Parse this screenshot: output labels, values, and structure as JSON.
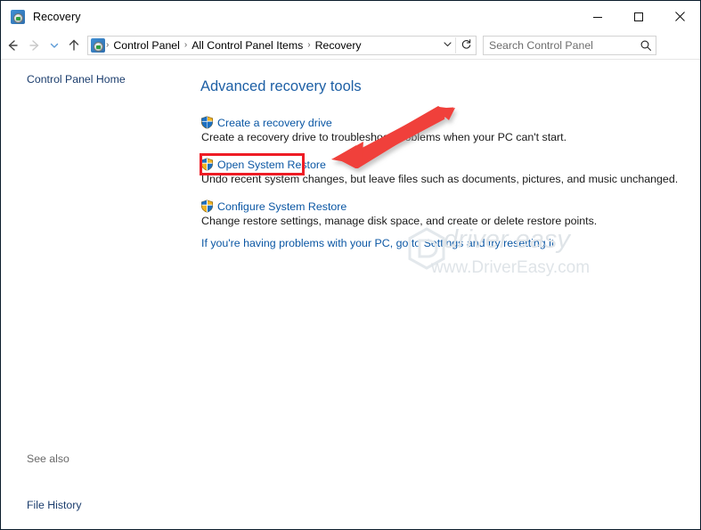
{
  "window": {
    "title": "Recovery",
    "app_icon": "recovery-icon",
    "minimize_label": "─",
    "maximize_label": "□",
    "close_label": "✕"
  },
  "toolbar": {
    "back_label": "←",
    "forward_label": "→",
    "recent_label": "∨",
    "up_label": "↑",
    "breadcrumbs": [
      "Control Panel",
      "All Control Panel Items",
      "Recovery"
    ],
    "breadcrumb_separator": "›",
    "dropdown_label": "⌄",
    "refresh_label": "↻",
    "help_label": "?"
  },
  "search": {
    "placeholder": "Search Control Panel",
    "value": "",
    "icon": "search-icon"
  },
  "sidebar": {
    "home_label": "Control Panel Home",
    "see_also_label": "See also",
    "see_also_items": [
      "File History"
    ]
  },
  "main": {
    "heading": "Advanced recovery tools",
    "tasks": [
      {
        "link": "Create a recovery drive",
        "description": "Create a recovery drive to troubleshoot problems when your PC can't start.",
        "icon": "uac-shield-icon"
      },
      {
        "link": "Open System Restore",
        "description": "Undo recent system changes, but leave files such as documents, pictures, and music unchanged.",
        "icon": "uac-shield-icon"
      },
      {
        "link": "Configure System Restore",
        "description": "Change restore settings, manage disk space, and create or delete restore points.",
        "icon": "uac-shield-icon"
      }
    ],
    "settings_link": "If you're having problems with your PC, go to Settings and try resetting it"
  },
  "annotations": {
    "highlight_target": "Open System Restore",
    "highlight_color": "#ee1c25",
    "arrow_color": "#f0403a"
  },
  "watermark": {
    "top_text": "driver easy",
    "bottom_text": "www.DriverEasy.com",
    "color": "#dfe4e8"
  }
}
